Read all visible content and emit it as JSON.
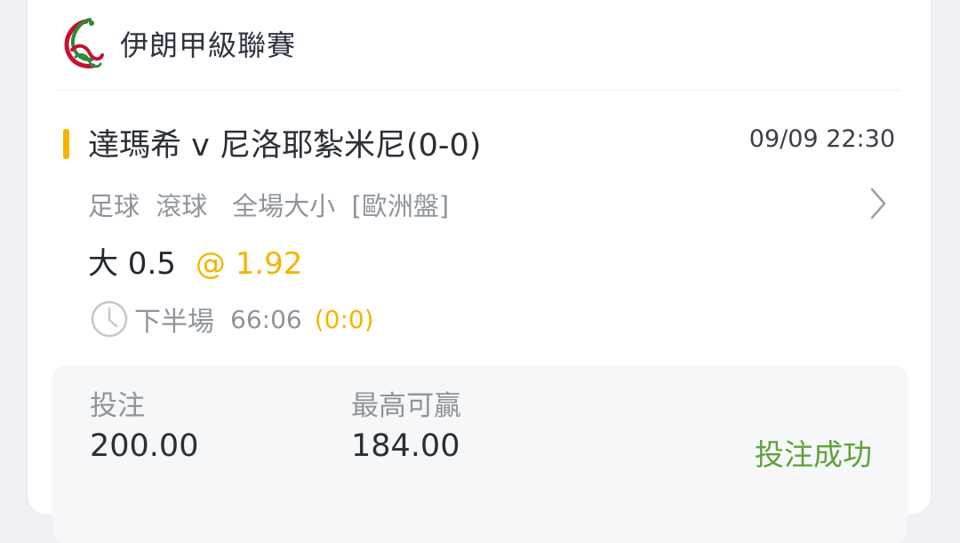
{
  "colors": {
    "accent": "#f5b400",
    "success": "#5fa33a",
    "text_primary": "#2b2f36",
    "text_secondary": "#8e949c"
  },
  "league": {
    "name": "伊朗甲級聯賽",
    "logo_icon": "league-logo-icon"
  },
  "match": {
    "title": "達瑪希 v 尼洛耶紮米尼(0-0)",
    "datetime": "09/09 22:30",
    "bet_type": "足球  滾球   全場大小  [歐洲盤]",
    "detail_icon": "chevron-right-icon"
  },
  "selection": {
    "pick": "大 0.5",
    "odds": "@ 1.92"
  },
  "live_status": {
    "icon": "clock-icon",
    "period": "下半場",
    "clock": "66:06",
    "score": "(0:0)"
  },
  "summary": {
    "stake_label": "投注",
    "stake_value": "200.00",
    "max_win_label": "最高可贏",
    "max_win_value": "184.00",
    "status": "投注成功"
  }
}
